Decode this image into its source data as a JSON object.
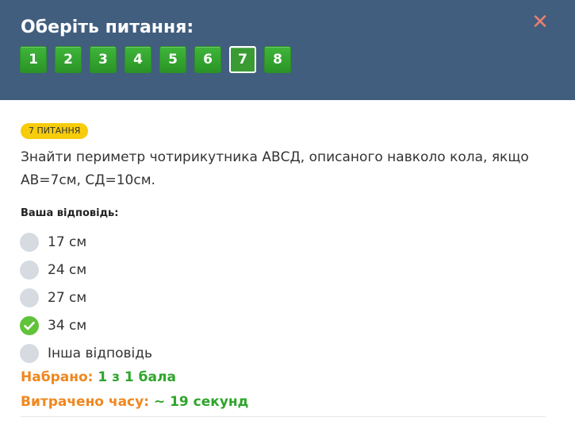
{
  "header": {
    "title": "Оберіть питання:",
    "close_icon": "close-icon",
    "questions": [
      "1",
      "2",
      "3",
      "4",
      "5",
      "6",
      "7",
      "8"
    ],
    "active_question": "7"
  },
  "colors": {
    "header_bg": "#415e7e",
    "button_green": "#3a9b33",
    "badge_yellow": "#f7cc0b",
    "close_red": "#e8806e",
    "label_orange": "#f0871e",
    "value_green": "#2ea52a",
    "radio_grey": "#d6dbe2",
    "check_green": "#60c33a"
  },
  "question": {
    "badge": "7 питання",
    "text": "Знайти периметр чотирикутника АВСД, описаного навколо кола, якщо АВ=7см, СД=10см."
  },
  "answers": {
    "label": "Ваша відповідь:",
    "options": [
      "17 см",
      "24 см",
      "27 см",
      "34 см",
      "Інша відповідь"
    ],
    "selected": "34 см"
  },
  "result": {
    "score_label": "Набрано:",
    "score_value": "1 з 1 бала",
    "time_label": "Витрачено часу:",
    "time_value": "~ 19 секунд"
  }
}
